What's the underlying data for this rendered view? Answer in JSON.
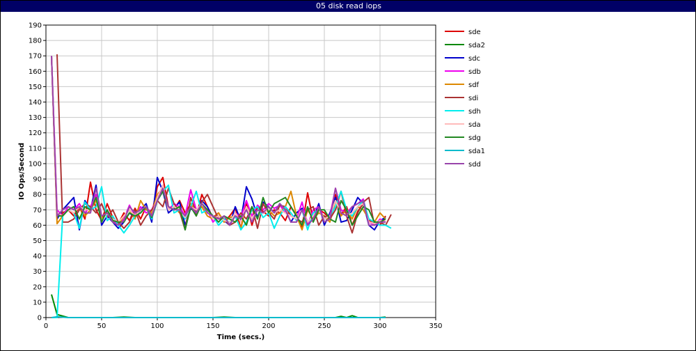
{
  "window": {
    "title": "05 disk read iops"
  },
  "chart_data": {
    "type": "line",
    "title": "05 disk read iops",
    "xlabel": "Time (secs.)",
    "ylabel": "IO Ops/Second",
    "xlim": [
      0,
      350
    ],
    "ylim": [
      0,
      190
    ],
    "xticks": [
      0,
      50,
      100,
      150,
      200,
      250,
      300,
      350
    ],
    "yticks": [
      0,
      10,
      20,
      30,
      40,
      50,
      60,
      70,
      80,
      90,
      100,
      110,
      120,
      130,
      140,
      150,
      160,
      170,
      180,
      190
    ],
    "grid": true,
    "legend_position": "right",
    "series": [
      {
        "name": "sde",
        "color": "#dd0000",
        "x": [
          5,
          10,
          15,
          20,
          25,
          30,
          35,
          40,
          45,
          50,
          55,
          60,
          65,
          70,
          75,
          80,
          85,
          90,
          95,
          100,
          105,
          110,
          115,
          120,
          125,
          130,
          135,
          140,
          145,
          150,
          155,
          160,
          165,
          170,
          175,
          180,
          185,
          190,
          195,
          200,
          205,
          210,
          215,
          220,
          225,
          230,
          235,
          240,
          245,
          250,
          255,
          260,
          265,
          270,
          275,
          280,
          285,
          290,
          295,
          300,
          305
        ],
        "y": [
          170,
          65,
          68,
          70,
          66,
          72,
          64,
          88,
          70,
          63,
          74,
          65,
          61,
          68,
          63,
          71,
          64,
          72,
          67,
          85,
          91,
          72,
          70,
          76,
          68,
          74,
          66,
          80,
          72,
          65,
          68,
          62,
          66,
          71,
          58,
          74,
          60,
          72,
          69,
          66,
          70,
          68,
          63,
          72,
          66,
          59,
          81,
          63,
          70,
          68,
          64,
          80,
          67,
          72,
          60,
          69,
          74,
          63,
          62,
          60,
          66
        ]
      },
      {
        "name": "sda2",
        "color": "#008800",
        "x": [
          5,
          10,
          20,
          30,
          40,
          50,
          60,
          70,
          80,
          90,
          100,
          110,
          120,
          130,
          140,
          150,
          160,
          170,
          180,
          190,
          200,
          210,
          220,
          230,
          240,
          250,
          260,
          265,
          270,
          275,
          280,
          290,
          300,
          305
        ],
        "y": [
          15,
          2,
          0,
          0,
          0,
          0,
          0,
          0.3,
          0,
          0,
          0,
          0,
          0,
          0,
          0,
          0,
          0.3,
          0,
          0,
          0,
          0,
          0,
          0,
          0,
          0,
          0,
          0,
          0.8,
          0,
          1.2,
          0,
          0,
          0,
          0.3
        ]
      },
      {
        "name": "sdc",
        "color": "#0000cc",
        "x": [
          5,
          10,
          15,
          20,
          25,
          30,
          35,
          40,
          45,
          50,
          55,
          60,
          65,
          70,
          75,
          80,
          85,
          90,
          95,
          100,
          105,
          110,
          115,
          120,
          125,
          130,
          135,
          140,
          145,
          150,
          155,
          160,
          165,
          170,
          175,
          180,
          185,
          190,
          195,
          200,
          205,
          210,
          215,
          220,
          225,
          230,
          235,
          240,
          245,
          250,
          255,
          260,
          265,
          270,
          275,
          280,
          285,
          290,
          295,
          300,
          305
        ],
        "y": [
          170,
          64,
          70,
          74,
          78,
          57,
          76,
          70,
          86,
          60,
          66,
          62,
          58,
          62,
          68,
          65,
          70,
          74,
          62,
          91,
          82,
          68,
          71,
          75,
          60,
          71,
          68,
          76,
          72,
          64,
          66,
          63,
          60,
          72,
          63,
          85,
          77,
          65,
          75,
          72,
          68,
          74,
          70,
          62,
          68,
          71,
          62,
          64,
          74,
          60,
          68,
          78,
          62,
          63,
          70,
          78,
          74,
          60,
          57,
          63,
          65
        ]
      },
      {
        "name": "sdb",
        "color": "#ee00ee",
        "x": [
          5,
          10,
          15,
          20,
          25,
          30,
          35,
          40,
          45,
          50,
          55,
          60,
          65,
          70,
          75,
          80,
          85,
          90,
          95,
          100,
          105,
          110,
          115,
          120,
          125,
          130,
          135,
          140,
          145,
          150,
          155,
          160,
          165,
          170,
          175,
          180,
          185,
          190,
          195,
          200,
          205,
          210,
          215,
          220,
          225,
          230,
          235,
          240,
          245,
          250,
          255,
          260,
          265,
          270,
          275,
          280,
          285,
          290,
          295,
          300,
          305
        ],
        "y": [
          170,
          70,
          66,
          72,
          70,
          74,
          68,
          72,
          80,
          62,
          70,
          63,
          60,
          64,
          73,
          66,
          72,
          68,
          70,
          78,
          86,
          70,
          74,
          72,
          66,
          83,
          70,
          74,
          70,
          62,
          66,
          64,
          60,
          68,
          65,
          76,
          66,
          73,
          70,
          74,
          71,
          73,
          68,
          66,
          64,
          75,
          60,
          70,
          72,
          64,
          66,
          84,
          70,
          68,
          72,
          74,
          77,
          62,
          60,
          64,
          62
        ]
      },
      {
        "name": "sdf",
        "color": "#dd8800",
        "x": [
          5,
          10,
          15,
          20,
          25,
          30,
          35,
          40,
          45,
          50,
          55,
          60,
          65,
          70,
          75,
          80,
          85,
          90,
          95,
          100,
          105,
          110,
          115,
          120,
          125,
          130,
          135,
          140,
          145,
          150,
          155,
          160,
          165,
          170,
          175,
          180,
          185,
          190,
          195,
          200,
          205,
          210,
          215,
          220,
          225,
          230,
          235,
          240,
          245,
          250,
          255,
          260,
          265,
          270,
          275,
          280,
          285,
          290,
          295,
          300,
          305
        ],
        "y": [
          170,
          61,
          66,
          70,
          68,
          72,
          66,
          70,
          76,
          64,
          68,
          62,
          60,
          66,
          70,
          64,
          76,
          70,
          68,
          80,
          84,
          70,
          72,
          68,
          65,
          74,
          68,
          72,
          66,
          64,
          68,
          62,
          65,
          66,
          58,
          72,
          64,
          70,
          68,
          70,
          66,
          68,
          72,
          82,
          66,
          57,
          70,
          64,
          68,
          66,
          62,
          76,
          66,
          70,
          64,
          72,
          70,
          64,
          62,
          68,
          64
        ]
      },
      {
        "name": "sdi",
        "color": "#aa3333",
        "x": [
          10,
          15,
          20,
          25,
          30,
          35,
          40,
          45,
          50,
          55,
          60,
          65,
          70,
          75,
          80,
          85,
          90,
          95,
          100,
          105,
          110,
          115,
          120,
          125,
          130,
          135,
          140,
          145,
          150,
          155,
          160,
          165,
          170,
          175,
          180,
          185,
          190,
          195,
          200,
          205,
          210,
          215,
          220,
          225,
          230,
          235,
          240,
          245,
          250,
          255,
          260,
          265,
          270,
          275,
          280,
          285,
          290,
          295,
          300,
          305,
          310
        ],
        "y": [
          171,
          62,
          62,
          64,
          70,
          74,
          72,
          68,
          74,
          65,
          70,
          62,
          58,
          62,
          70,
          60,
          66,
          70,
          76,
          72,
          84,
          74,
          69,
          57,
          78,
          68,
          75,
          80,
          72,
          64,
          64,
          60,
          62,
          68,
          64,
          72,
          58,
          74,
          68,
          64,
          73,
          72,
          66,
          64,
          62,
          70,
          72,
          60,
          66,
          64,
          70,
          82,
          66,
          55,
          68,
          75,
          78,
          60,
          62,
          60,
          67
        ]
      },
      {
        "name": "sdh",
        "color": "#00eeee",
        "x": [
          5,
          10,
          15,
          20,
          25,
          30,
          35,
          40,
          45,
          50,
          55,
          60,
          65,
          70,
          75,
          80,
          85,
          90,
          95,
          100,
          105,
          110,
          115,
          120,
          125,
          130,
          135,
          140,
          145,
          150,
          155,
          160,
          165,
          170,
          175,
          180,
          185,
          190,
          195,
          200,
          205,
          210,
          215,
          220,
          225,
          230,
          235,
          240,
          245,
          250,
          255,
          260,
          265,
          270,
          275,
          280,
          285,
          290,
          295,
          300,
          305,
          310
        ],
        "y": [
          0,
          0,
          66,
          70,
          68,
          58,
          75,
          70,
          72,
          85,
          63,
          66,
          60,
          55,
          60,
          66,
          68,
          72,
          64,
          76,
          82,
          86,
          68,
          70,
          64,
          72,
          82,
          68,
          70,
          66,
          60,
          64,
          62,
          66,
          57,
          62,
          70,
          72,
          65,
          68,
          58,
          66,
          72,
          68,
          63,
          70,
          57,
          68,
          70,
          64,
          66,
          72,
          82,
          70,
          66,
          72,
          76,
          64,
          62,
          60,
          60,
          58
        ]
      },
      {
        "name": "sda",
        "color": "#ffbbbb",
        "x": [
          5,
          10,
          15,
          20,
          25,
          30,
          35,
          40,
          45,
          50,
          55,
          60,
          65,
          70,
          75,
          80,
          85,
          90,
          95,
          100,
          105,
          110,
          115,
          120,
          125,
          130,
          135,
          140,
          145,
          150,
          155,
          160,
          165,
          170,
          175,
          180,
          185,
          190,
          195,
          200,
          205,
          210,
          215,
          220,
          225,
          230,
          235,
          240,
          245,
          250,
          255,
          260,
          265,
          270,
          275,
          280,
          285,
          290,
          295,
          300,
          305
        ],
        "y": [
          170,
          68,
          66,
          70,
          68,
          72,
          70,
          70,
          78,
          63,
          68,
          64,
          62,
          66,
          70,
          66,
          70,
          72,
          66,
          78,
          86,
          70,
          72,
          70,
          65,
          72,
          70,
          74,
          70,
          64,
          66,
          63,
          62,
          68,
          62,
          72,
          64,
          70,
          68,
          70,
          68,
          70,
          68,
          66,
          64,
          70,
          62,
          66,
          70,
          64,
          66,
          76,
          68,
          66,
          68,
          72,
          74,
          62,
          61,
          63,
          63
        ]
      },
      {
        "name": "sdg",
        "color": "#228822",
        "x": [
          10,
          15,
          20,
          25,
          30,
          35,
          40,
          45,
          50,
          55,
          60,
          65,
          70,
          75,
          80,
          85,
          90,
          95,
          100,
          105,
          110,
          115,
          120,
          125,
          130,
          135,
          140,
          145,
          150,
          155,
          160,
          165,
          170,
          175,
          180,
          185,
          190,
          195,
          200,
          205,
          210,
          215,
          220,
          225,
          230,
          235,
          240,
          245,
          250,
          255,
          260,
          265,
          270,
          275,
          280,
          285,
          290,
          295,
          300,
          305
        ],
        "y": [
          66,
          66,
          70,
          72,
          64,
          72,
          70,
          78,
          62,
          70,
          63,
          62,
          62,
          68,
          66,
          68,
          72,
          65,
          76,
          82,
          72,
          70,
          72,
          57,
          72,
          66,
          74,
          70,
          66,
          62,
          66,
          64,
          62,
          66,
          60,
          72,
          64,
          78,
          68,
          74,
          76,
          78,
          72,
          66,
          60,
          72,
          62,
          70,
          70,
          64,
          62,
          76,
          70,
          60,
          66,
          72,
          70,
          62,
          62,
          64
        ]
      },
      {
        "name": "sda1",
        "color": "#00bbcc",
        "x": [
          5,
          10,
          20,
          30,
          40,
          50,
          60,
          70,
          80,
          90,
          100,
          110,
          120,
          130,
          140,
          150,
          160,
          170,
          180,
          190,
          200,
          210,
          220,
          230,
          240,
          250,
          260,
          270,
          280,
          290,
          300,
          305
        ],
        "y": [
          0,
          0.5,
          0,
          0,
          0,
          0,
          0,
          0,
          0,
          0,
          0,
          0,
          0,
          0,
          0,
          0,
          0,
          0,
          0,
          0,
          0,
          0,
          0,
          0,
          0,
          0,
          0,
          0,
          0,
          0,
          0,
          0
        ]
      },
      {
        "name": "sdd",
        "color": "#9944aa",
        "x": [
          5,
          10,
          15,
          20,
          25,
          30,
          35,
          40,
          45,
          50,
          55,
          60,
          65,
          70,
          75,
          80,
          85,
          90,
          95,
          100,
          105,
          110,
          115,
          120,
          125,
          130,
          135,
          140,
          145,
          150,
          155,
          160,
          165,
          170,
          175,
          180,
          185,
          190,
          195,
          200,
          205,
          210,
          215,
          220,
          225,
          230,
          235,
          240,
          245,
          250,
          255,
          260,
          265,
          270,
          275,
          280,
          285,
          290,
          295,
          300,
          305
        ],
        "y": [
          170,
          66,
          70,
          72,
          70,
          72,
          68,
          68,
          84,
          66,
          68,
          62,
          60,
          63,
          72,
          68,
          70,
          72,
          66,
          76,
          84,
          72,
          70,
          70,
          66,
          72,
          68,
          74,
          68,
          66,
          64,
          66,
          60,
          66,
          64,
          70,
          62,
          70,
          68,
          72,
          68,
          74,
          70,
          62,
          62,
          70,
          60,
          64,
          72,
          62,
          64,
          84,
          68,
          66,
          72,
          74,
          76,
          60,
          60,
          62,
          62
        ]
      }
    ]
  }
}
